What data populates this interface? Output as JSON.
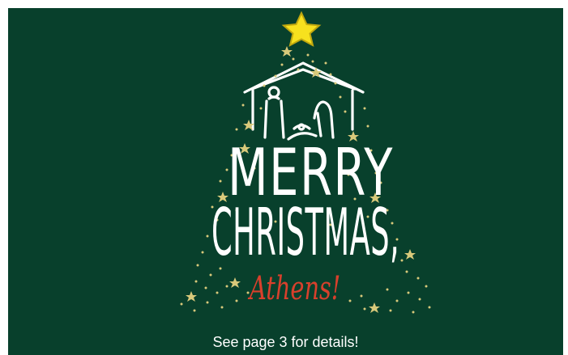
{
  "card": {
    "headline_line1": "MERRY",
    "headline_line2": "CHRISTMAS,",
    "greeting": "Athens!",
    "note": "See page 3 for details!"
  },
  "colors": {
    "background": "#08402c",
    "text": "#ffffff",
    "accent_red": "#d8402c",
    "star_gold": "#d8c97a",
    "top_star": "#f7e11e"
  },
  "icons": {
    "top": "star-icon",
    "art": "nativity-scene-icon",
    "decoration": "small-star-icon"
  }
}
